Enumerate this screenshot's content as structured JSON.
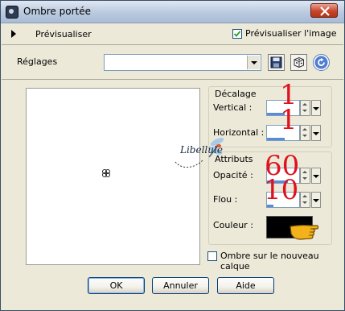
{
  "window": {
    "title": "Ombre portée"
  },
  "preview_row": {
    "label": "Prévisualiser",
    "checkbox_label": "Prévisualiser l'image",
    "checked": true
  },
  "reglages": {
    "label": "Réglages",
    "value": ""
  },
  "decalage": {
    "title": "Décalage",
    "vertical_label": "Vertical :",
    "vertical_value": "1",
    "horizontal_label": "Horizontal :",
    "horizontal_value": "1"
  },
  "attributs": {
    "title": "Attributs",
    "opacite_label": "Opacité :",
    "opacite_value": "60",
    "flou_label": "Flou :",
    "flou_value": "10",
    "couleur_label": "Couleur :",
    "couleur_value": "#000000"
  },
  "ombre_checkbox": {
    "label": "Ombre sur le nouveau calque",
    "checked": false
  },
  "buttons": {
    "ok": "OK",
    "annuler": "Annuler",
    "aide": "Aide"
  },
  "watermark": {
    "text": "Libellule"
  },
  "icons": {
    "save": "save-icon",
    "random": "dice-icon",
    "reset": "reset-icon",
    "close": "close-icon"
  },
  "colors": {
    "accent_red": "#e0121e",
    "hand": "#f3b11a"
  }
}
